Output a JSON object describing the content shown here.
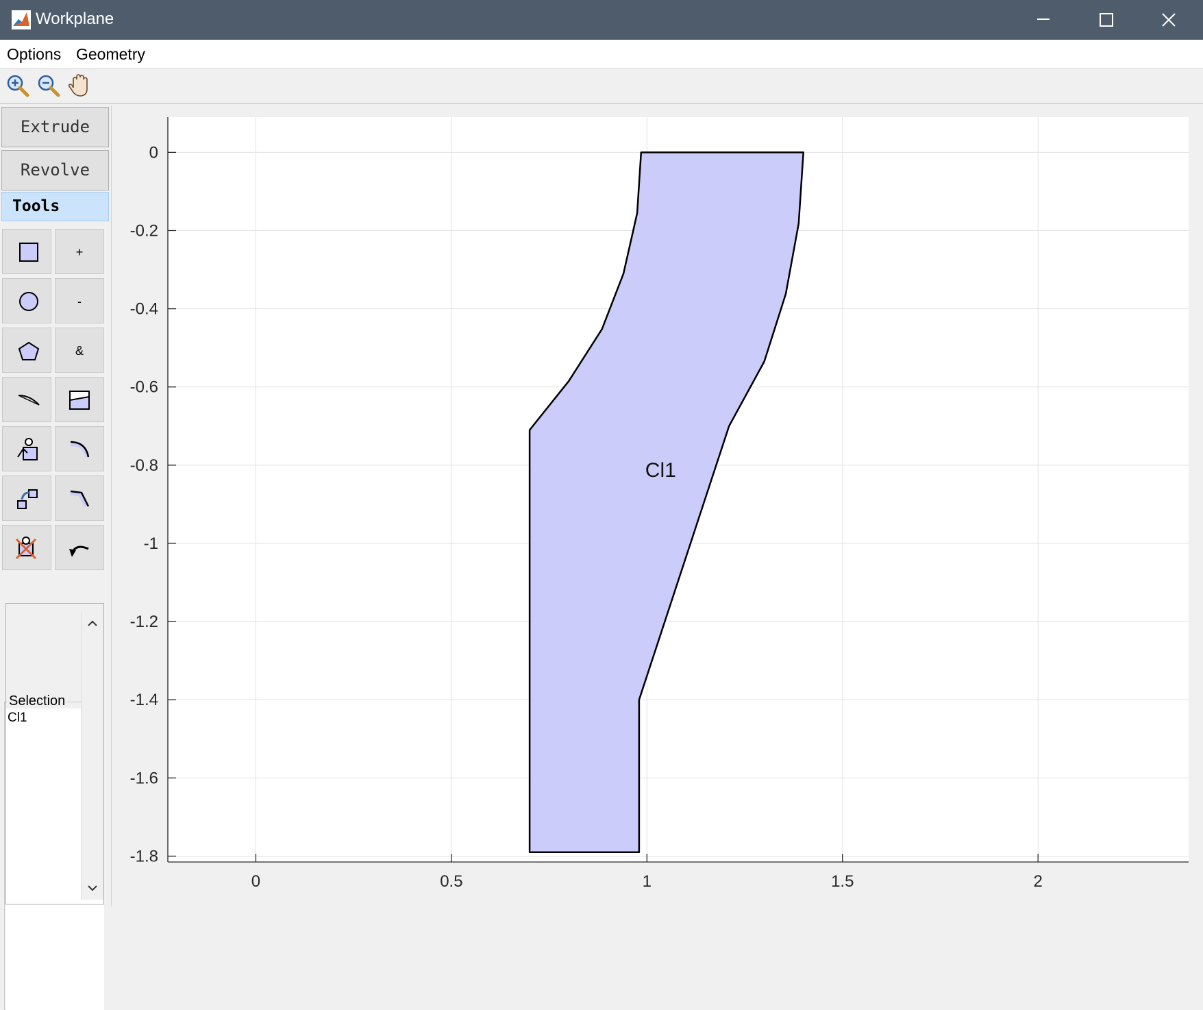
{
  "window": {
    "title": "Workplane",
    "controls": [
      "minimize-icon",
      "maximize-icon",
      "close-icon"
    ]
  },
  "menubar": {
    "items": [
      "Options",
      "Geometry"
    ]
  },
  "toolbar": {
    "icons": [
      "zoom-in-icon",
      "zoom-out-icon",
      "pan-hand-icon"
    ]
  },
  "leftpanel": {
    "extrude_label": "Extrude",
    "revolve_label": "Revolve",
    "tools_label": "Tools",
    "tools": [
      [
        "rectangle-icon",
        "+"
      ],
      [
        "circle-icon",
        "-"
      ],
      [
        "polygon-icon",
        "&"
      ],
      [
        "line-icon",
        "split-icon"
      ],
      [
        "transform-icon",
        "fillet-icon"
      ],
      [
        "move-icon",
        "chamfer-icon"
      ],
      [
        "delete-icon",
        "undo-icon"
      ]
    ],
    "selection_label": "Selection",
    "selection_items": [
      "Cl1"
    ]
  },
  "colors": {
    "titlebar": "#4e5c6c",
    "shape_fill": "#ccccfa",
    "tools_tab": "#cce4fb"
  },
  "chart_data": {
    "type": "geometry",
    "xlim": [
      -0.225,
      2.385
    ],
    "ylim": [
      -1.815,
      0.09
    ],
    "xticks": [
      0,
      0.5,
      1,
      1.5,
      2
    ],
    "yticks": [
      0,
      -0.2,
      -0.4,
      -0.6,
      -0.8,
      -1,
      -1.2,
      -1.4,
      -1.6,
      -1.8
    ],
    "xtick_labels": [
      "0",
      "0.5",
      "1",
      "1.5",
      "2"
    ],
    "ytick_labels": [
      "0",
      "-0.2",
      "-0.4",
      "-0.6",
      "-0.8",
      "-1",
      "-1.2",
      "-1.4",
      "-1.6",
      "-1.8"
    ],
    "grid": true,
    "shapes": [
      {
        "label": "Cl1",
        "label_pos": [
          1.035,
          -0.83
        ],
        "polygon": [
          [
            1.0,
            0.0
          ],
          [
            1.4,
            0.0
          ],
          [
            1.388,
            -0.182
          ],
          [
            1.355,
            -0.362
          ],
          [
            1.3,
            -0.535
          ],
          [
            1.21,
            -0.7
          ],
          [
            0.98,
            -1.4
          ],
          [
            0.98,
            -1.79
          ],
          [
            0.7,
            -1.79
          ],
          [
            0.7,
            -0.71
          ],
          [
            0.8,
            -0.585
          ],
          [
            0.885,
            -0.452
          ],
          [
            0.94,
            -0.31
          ],
          [
            0.975,
            -0.155
          ],
          [
            0.985,
            0.0
          ]
        ]
      }
    ]
  }
}
